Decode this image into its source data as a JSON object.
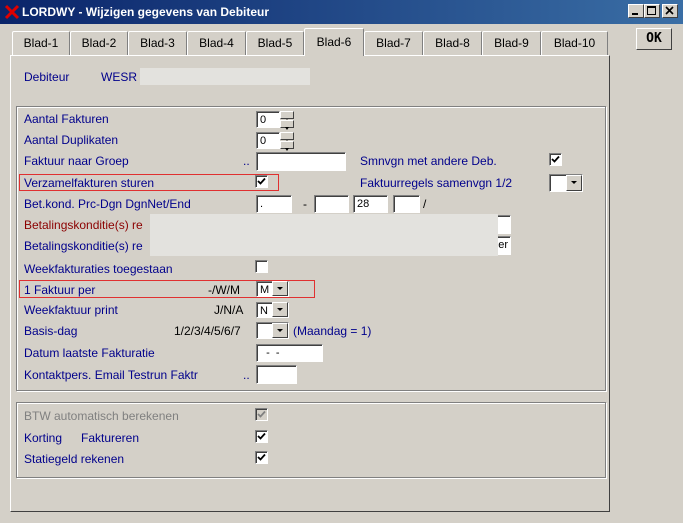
{
  "window": {
    "title": "LORDWY - Wijzigen gegevens van Debiteur",
    "app_icon_color": "#e00000",
    "minimize_label": "_",
    "maximize_label": "□",
    "close_label": "✕"
  },
  "ok_button": {
    "label": "OK"
  },
  "tabs": [
    {
      "label": "Blad-1"
    },
    {
      "label": "Blad-2"
    },
    {
      "label": "Blad-3"
    },
    {
      "label": "Blad-4"
    },
    {
      "label": "Blad-5"
    },
    {
      "label": "Blad-6",
      "active": true
    },
    {
      "label": "Blad-7"
    },
    {
      "label": "Blad-8"
    },
    {
      "label": "Blad-9"
    },
    {
      "label": "Blad-10"
    }
  ],
  "debiteur": {
    "label": "Debiteur",
    "code": "WESR"
  },
  "form": {
    "aantal_fakturen": {
      "label": "Aantal Fakturen",
      "value": "0"
    },
    "aantal_duplikaten": {
      "label": "Aantal Duplikaten",
      "value": "0"
    },
    "faktuur_naar_groep": {
      "label": "Faktuur naar Groep",
      "dots": "..",
      "value": ""
    },
    "smnvgn": {
      "label": "Smnvgn met andere Deb.",
      "checked": true
    },
    "verzamelfakturen": {
      "label": "Verzamelfakturen sturen",
      "checked": true
    },
    "faktuurregels": {
      "label": "Faktuurregels samenvgn 1/2",
      "value": ""
    },
    "betkond": {
      "label": "Bet.kond. Prc-Dgn DgnNet/End",
      "field1": ".",
      "sep1": "-",
      "field2": "",
      "field3": "28",
      "field4": "",
      "sep2": "/"
    },
    "betalingskonditie1": {
      "label": "Betalingskonditie(s) re",
      "value": ""
    },
    "betalingskonditie2": {
      "label": "Betalingskonditie(s) re",
      "value": "er"
    },
    "weekfakturaties": {
      "label": "Weekfakturaties toegestaan",
      "checked": false
    },
    "faktuur_per": {
      "label": "1 Faktuur per",
      "hint": "-/W/M",
      "value": "M"
    },
    "weekfaktuur_print": {
      "label": "Weekfaktuur print",
      "hint": "J/N/A",
      "value": "N"
    },
    "basis_dag": {
      "label": "Basis-dag",
      "hint": "1/2/3/4/5/6/7",
      "value": "",
      "note": "(Maandag  =  1)"
    },
    "datum_laatste": {
      "label": "Datum laatste Fakturatie",
      "value": "  -  -"
    },
    "kontaktpers": {
      "label": "Kontaktpers. Email Testrun Faktr",
      "dots": "..",
      "value": ""
    }
  },
  "bottom": {
    "btw": {
      "label": "BTW automatisch berekenen",
      "checked": true,
      "disabled": true
    },
    "korting": {
      "label": "Korting",
      "label2": "Faktureren",
      "checked": true
    },
    "statiegeld": {
      "label": "Statiegeld rekenen",
      "checked": true
    }
  },
  "colors": {
    "label": "#00008b",
    "label_red": "#8b0000",
    "highlight": "#e03030",
    "face": "#d4d0c8"
  }
}
